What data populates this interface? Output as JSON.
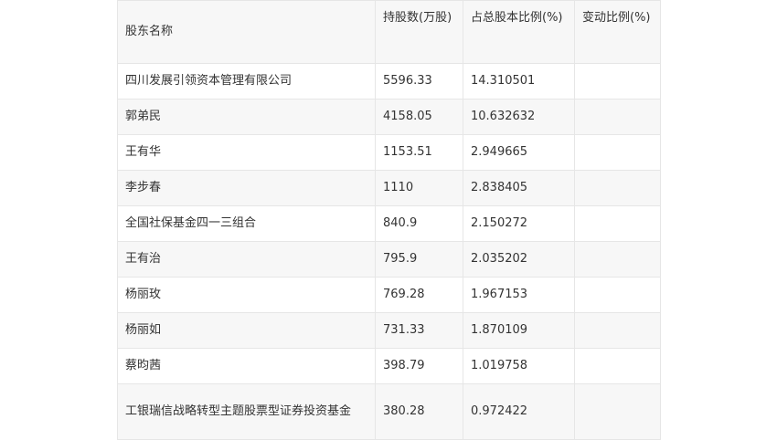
{
  "table": {
    "headers": [
      "股东名称",
      "持股数(万股)",
      "占总股本比例(%)",
      "变动比例(%)"
    ],
    "rows": [
      [
        "四川发展引领资本管理有限公司",
        "5596.33",
        "14.310501",
        ""
      ],
      [
        "郭弟民",
        "4158.05",
        "10.632632",
        ""
      ],
      [
        "王有华",
        "1153.51",
        "2.949665",
        ""
      ],
      [
        "李步春",
        "1110",
        "2.838405",
        ""
      ],
      [
        "全国社保基金四一三组合",
        "840.9",
        "2.150272",
        ""
      ],
      [
        "王有治",
        "795.9",
        "2.035202",
        ""
      ],
      [
        "杨丽玫",
        "769.28",
        "1.967153",
        ""
      ],
      [
        "杨丽如",
        "731.33",
        "1.870109",
        ""
      ],
      [
        "蔡昀茜",
        "398.79",
        "1.019758",
        ""
      ],
      [
        "工银瑞信战略转型主题股票型证券投资基金",
        "380.28",
        "0.972422",
        ""
      ]
    ]
  }
}
